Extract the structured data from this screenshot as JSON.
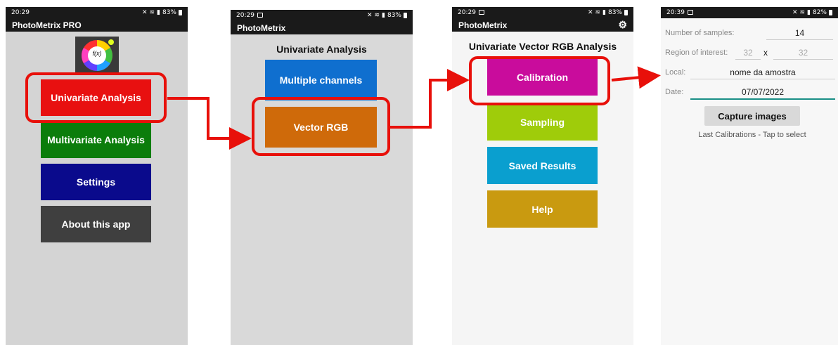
{
  "screen1": {
    "status_time": "20:29",
    "status_right": "83%",
    "app_title": "PhotoMetrix PRO",
    "logo_text": "f(x)",
    "buttons": {
      "univariate": "Univariate Analysis",
      "multivariate": "Multivariate Analysis",
      "settings": "Settings",
      "about": "About this app"
    },
    "colors": {
      "univariate": "#e81010",
      "multivariate": "#0b7d0b",
      "settings": "#0a0a8c",
      "about": "#3f3f3f"
    }
  },
  "screen2": {
    "status_time": "20:29",
    "status_right": "83%",
    "app_title": "PhotoMetrix",
    "heading": "Univariate Analysis",
    "buttons": {
      "multiple_channels": "Multiple channels",
      "vector_rgb": "Vector RGB"
    },
    "colors": {
      "multiple_channels": "#0f6fcf",
      "vector_rgb": "#cf6a0a"
    }
  },
  "screen3": {
    "status_time": "20:29",
    "status_right": "83%",
    "app_title": "PhotoMetrix",
    "heading": "Univariate Vector RGB Analysis",
    "buttons": {
      "calibration": "Calibration",
      "sampling": "Sampling",
      "saved_results": "Saved Results",
      "help": "Help"
    },
    "colors": {
      "calibration": "#c90c9c",
      "sampling": "#9fcc0a",
      "saved_results": "#0a9fcf",
      "help": "#c99a10"
    }
  },
  "screen4": {
    "status_time": "20:39",
    "status_right": "82%",
    "fields": {
      "num_samples_label": "Number of samples:",
      "num_samples_value": "14",
      "roi_label": "Region of interest:",
      "roi_x": "32",
      "roi_sep": "x",
      "roi_y": "32",
      "local_label": "Local:",
      "local_value": "nome da amostra",
      "date_label": "Date:",
      "date_value": "07/07/2022"
    },
    "capture_button": "Capture images",
    "last_calibrations": "Last Calibrations - Tap to select"
  },
  "highlight_color": "#e8100a"
}
